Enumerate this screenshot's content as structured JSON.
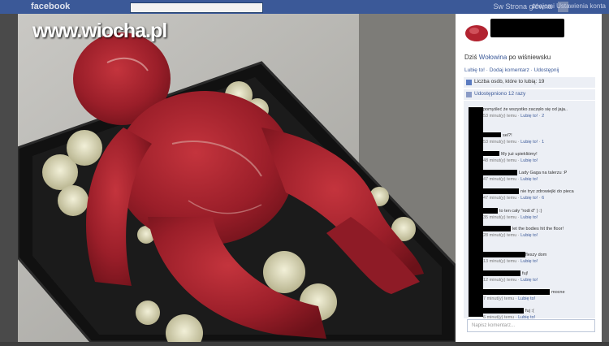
{
  "topbar": {
    "logo": "facebook",
    "links": "Sw   Strona główna",
    "user": "znajomi  Ustawienia konta"
  },
  "watermark": "www.wiocha.pl",
  "post": {
    "caption_prefix": "Dziś",
    "caption_link": "Wołowina",
    "caption_suffix": "po wiśniewsku",
    "actions": "Lubię to! · Dodaj komentarz · Udostępnij",
    "likes": "Liczba osób, które to lubią: 19",
    "shared": "Udostępniono 12 razy",
    "comment_placeholder": "Napisz komentarz..."
  },
  "comments": [
    {
      "text": "pomyśleć że wszystko zaczęło się od jaja..",
      "time": "53 minut(y) temu",
      "like": "Lubię to!",
      "count": "2"
    },
    {
      "text": "sel?!",
      "time": "53 minut(y) temu",
      "like": "Lubię to!",
      "count": "1"
    },
    {
      "text": "My już upiekliśmy!",
      "time": "48 minut(y) temu",
      "like": "Lubię to!",
      "count": ""
    },
    {
      "text": "Lady Gaga na talerzu :P",
      "time": "47 minut(y) temu",
      "like": "Lubię to!",
      "count": ""
    },
    {
      "text": "nie tryz zdrowiejki do pieca",
      "time": "47 minut(y) temu",
      "like": "Lubię to!",
      "count": "6"
    },
    {
      "text": "to ten cały \"rodi d\" ) :)",
      "time": "35 minut(y) temu",
      "like": "Lubię to!",
      "count": ""
    },
    {
      "text": "let the bodies hit the floor!",
      "time": "28 minut(y) temu",
      "like": "Lubię to!",
      "count": ""
    },
    {
      "text": "fleszy dom",
      "time": "13 minut(y) temu",
      "like": "Lubię to!",
      "count": ""
    },
    {
      "text": "fuj!",
      "time": "12 minut(y) temu",
      "like": "Lubię to!",
      "count": ""
    },
    {
      "text": "mocne",
      "time": "7 minut(y) temu",
      "like": "Lubię to!",
      "count": ""
    },
    {
      "text": "fuj :(",
      "time": "6 minut(y) temu",
      "like": "Lubię to!",
      "count": ""
    }
  ],
  "colors": {
    "facebook_blue": "#3b5998",
    "meat": "#a5232f",
    "tray": "#141414"
  }
}
